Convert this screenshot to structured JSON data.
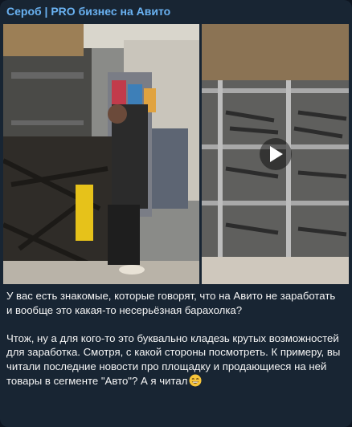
{
  "post": {
    "channel_name": "Сероб | PRO бизнес на Авито",
    "media": [
      {
        "kind": "photo",
        "subject": "man-sorting-auto-parts-in-warehouse"
      },
      {
        "kind": "video",
        "subject": "warehouse-shelves-with-auto-parts",
        "icon": "play-icon"
      }
    ],
    "paragraph_1": "У вас есть знакомые, которые говорят, что на Авито не заработать и вообще это какая-то несерьёзная барахолка?",
    "paragraph_2": "Чтож, ну а для кого-то это буквально кладезь крутых возможностей для заработка. Смотря, с какой стороны посмотреть. К примеру, вы читали последние новости про площадку и продающиеся на ней товары в сегменте \"Авто\"? А я читал",
    "emoji": "grinning-face-emoji"
  },
  "colors": {
    "bubble": "#182533",
    "channel_name": "#6ab2f2",
    "text": "#f5f5f5"
  }
}
